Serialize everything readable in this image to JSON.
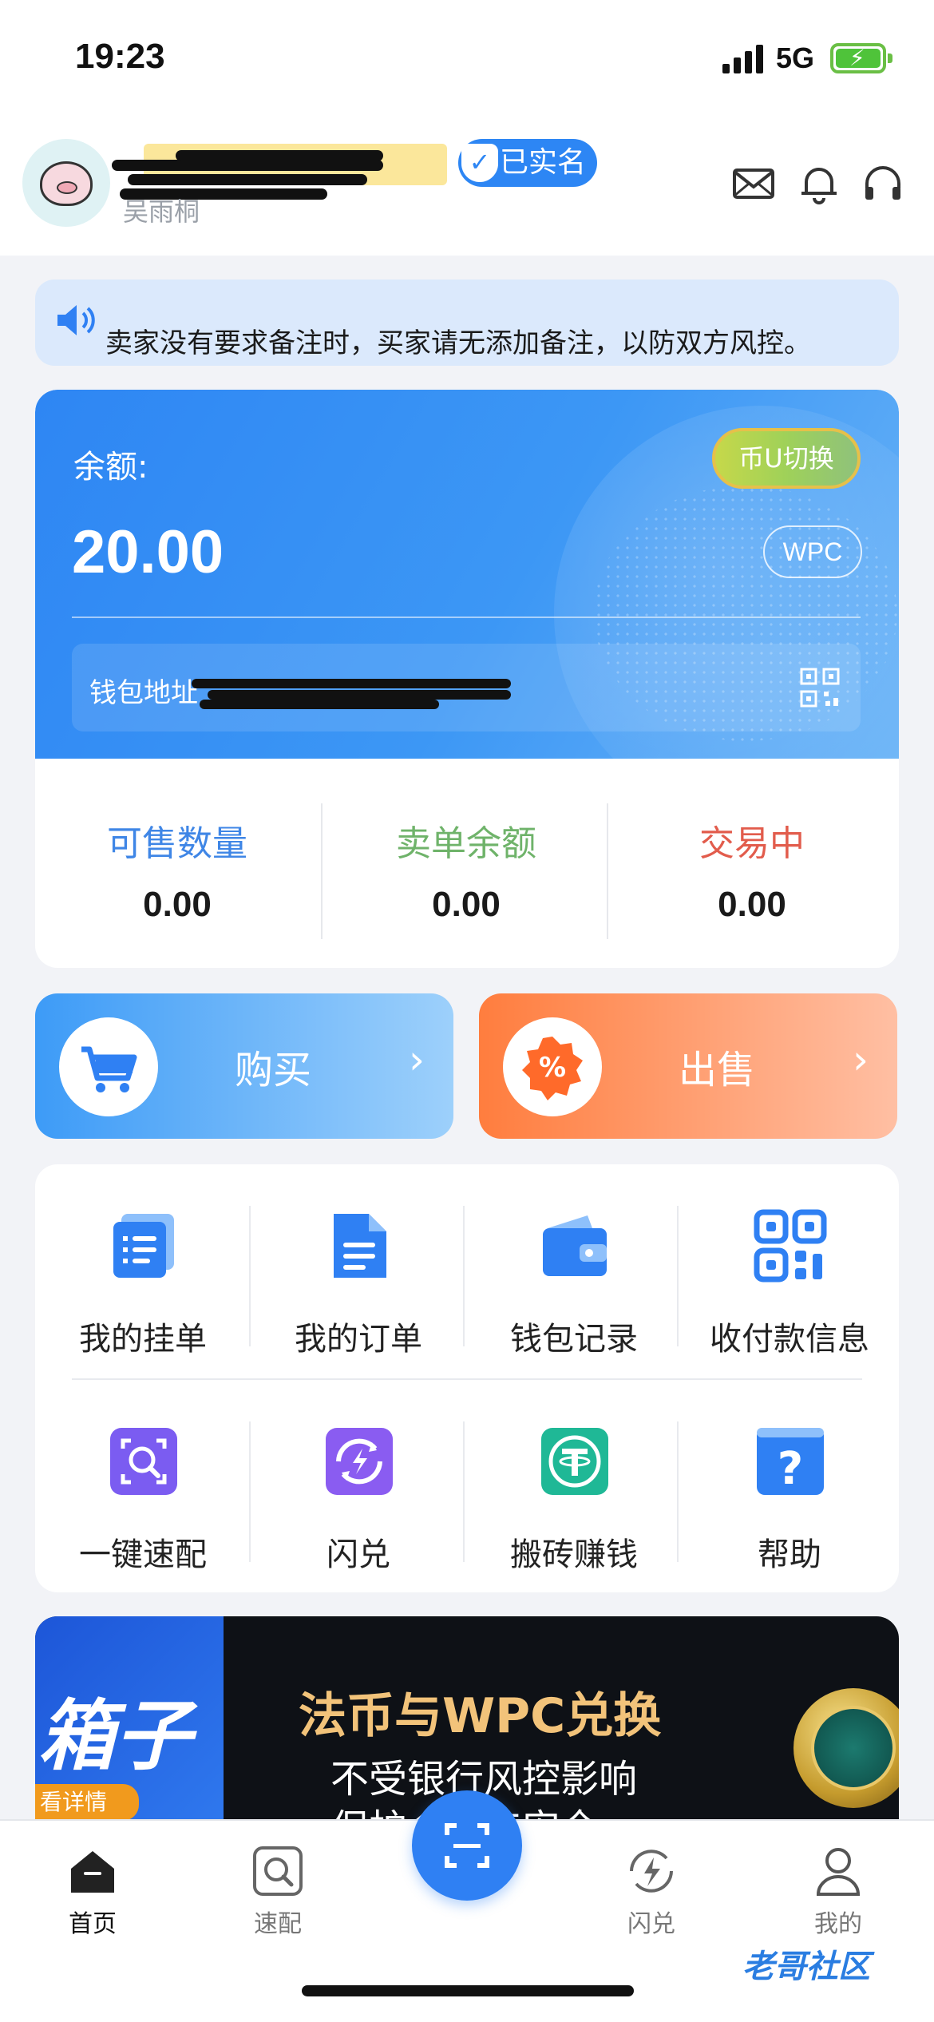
{
  "status_bar": {
    "time": "19:23",
    "network": "5G"
  },
  "header": {
    "username_sub": "吴雨桐",
    "verified_label": "已实名"
  },
  "notice": {
    "text": "卖家没有要求备注时，买家请无添加备注，以防双方风控。"
  },
  "wallet": {
    "balance_label": "余额:",
    "balance_value": "20.00",
    "switch_label": "币U切换",
    "unit_label": "WPC",
    "address_label": "钱包地址"
  },
  "stats": [
    {
      "title": "可售数量",
      "value": "0.00",
      "color": "#3f86e6"
    },
    {
      "title": "卖单余额",
      "value": "0.00",
      "color": "#6fb36a"
    },
    {
      "title": "交易中",
      "value": "0.00",
      "color": "#e25c4c"
    }
  ],
  "actions": {
    "buy_label": "购买",
    "sell_label": "出售"
  },
  "menu": [
    {
      "label": "我的挂单",
      "icon": "listing-icon"
    },
    {
      "label": "我的订单",
      "icon": "order-icon"
    },
    {
      "label": "钱包记录",
      "icon": "wallet-icon"
    },
    {
      "label": "收付款信息",
      "icon": "qrcode-icon"
    },
    {
      "label": "一键速配",
      "icon": "quick-match-icon"
    },
    {
      "label": "闪兑",
      "icon": "flash-exchange-icon"
    },
    {
      "label": "搬砖赚钱",
      "icon": "tether-icon"
    },
    {
      "label": "帮助",
      "icon": "help-icon"
    }
  ],
  "banner": {
    "left_big": "箱子",
    "left_detail": "看详情",
    "title": "法币与WPC兑换",
    "sub1": "不受银行风控影响",
    "sub2": "保护全资产安全"
  },
  "tabbar": [
    {
      "label": "首页",
      "icon": "home-icon"
    },
    {
      "label": "速配",
      "icon": "quick-match-icon"
    },
    {
      "label": "闪兑",
      "icon": "flash-exchange-icon"
    },
    {
      "label": "我的",
      "icon": "profile-icon"
    }
  ],
  "watermark": "老哥社区",
  "colors": {
    "primary": "#2f80f3",
    "buy": "#4aa6f8",
    "sell": "#ff8a52"
  }
}
